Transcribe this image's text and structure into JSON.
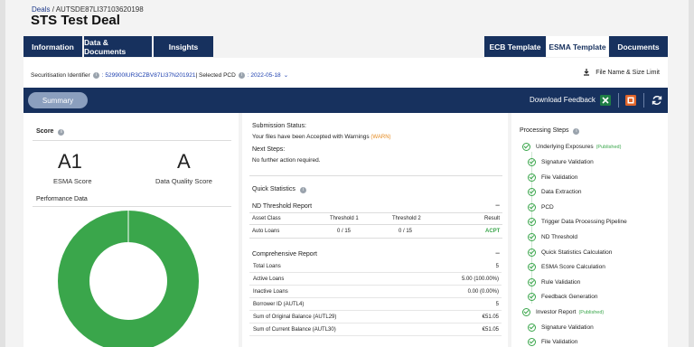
{
  "breadcrumb": {
    "root": "Deals",
    "separator": "/",
    "id": "AUTSDE87LI37103620198"
  },
  "title": "STS Test Deal",
  "tabs_left": [
    "Information",
    "Data & Documents",
    "Insights"
  ],
  "tabs_right": [
    "ECB Template",
    "ESMA Template",
    "Documents"
  ],
  "subbar": {
    "sec_label": "Securitisation Identifier",
    "sec_value": ": 529900IUR3CZBV87LI37N201921",
    "sep": " | Selected PCD",
    "pcd_value": ": 2022-05-18",
    "file_limit": "File Name & Size Limit"
  },
  "actions": {
    "summary": "Summary",
    "download": "Download Feedback"
  },
  "score": {
    "heading": "Score",
    "esma_value": "A1",
    "esma_label": "ESMA Score",
    "dq_value": "A",
    "dq_label": "Data Quality Score",
    "perf_heading": "Performance Data"
  },
  "status": {
    "heading": "Submission Status:",
    "text": "Your files have been Accepted with Warnings",
    "warn": "(WARN)",
    "next_heading": "Next Steps:",
    "next_text": "No further action required."
  },
  "quick": {
    "heading": "Quick Statistics",
    "nd_heading": "ND Threshold Report",
    "nd_collapse": "−",
    "nd_headers": [
      "Asset Class",
      "Threshold 1",
      "Threshold 2",
      "Result"
    ],
    "nd_row": [
      "Auto Loans",
      "0 / 15",
      "0 / 15",
      "ACPT"
    ],
    "comp_heading": "Comprehensive Report",
    "comp_collapse": "−",
    "comp_rows": [
      [
        "Total Loans",
        "5"
      ],
      [
        "Active Loans",
        "5.00 (100.00%)"
      ],
      [
        "Inactive Loans",
        "0.00 (0.00%)"
      ],
      [
        "Borrower ID (AUTL4)",
        "5"
      ],
      [
        "Sum of Original Balance (AUTL29)",
        "€51.05"
      ],
      [
        "Sum of Current Balance (AUTL30)",
        "€51.05"
      ]
    ]
  },
  "processing": {
    "heading": "Processing Steps",
    "groups": [
      {
        "label": "Underlying Exposures",
        "status": "(Published)"
      },
      {
        "label": "Investor Report",
        "status": "(Published)"
      }
    ],
    "steps1": [
      "Signature Validation",
      "File Validation",
      "Data Extraction",
      "PCD",
      "Trigger Data Processing Pipeline",
      "ND Threshold",
      "Quick Statistics Calculation",
      "ESMA Score Calculation",
      "Rule Validation",
      "Feedback Generation"
    ],
    "steps2": [
      "Signature Validation",
      "File Validation"
    ]
  },
  "chart_data": {
    "type": "pie",
    "categories": [
      ""
    ],
    "values": [
      100
    ],
    "colors": [
      "#3aa64b"
    ]
  }
}
